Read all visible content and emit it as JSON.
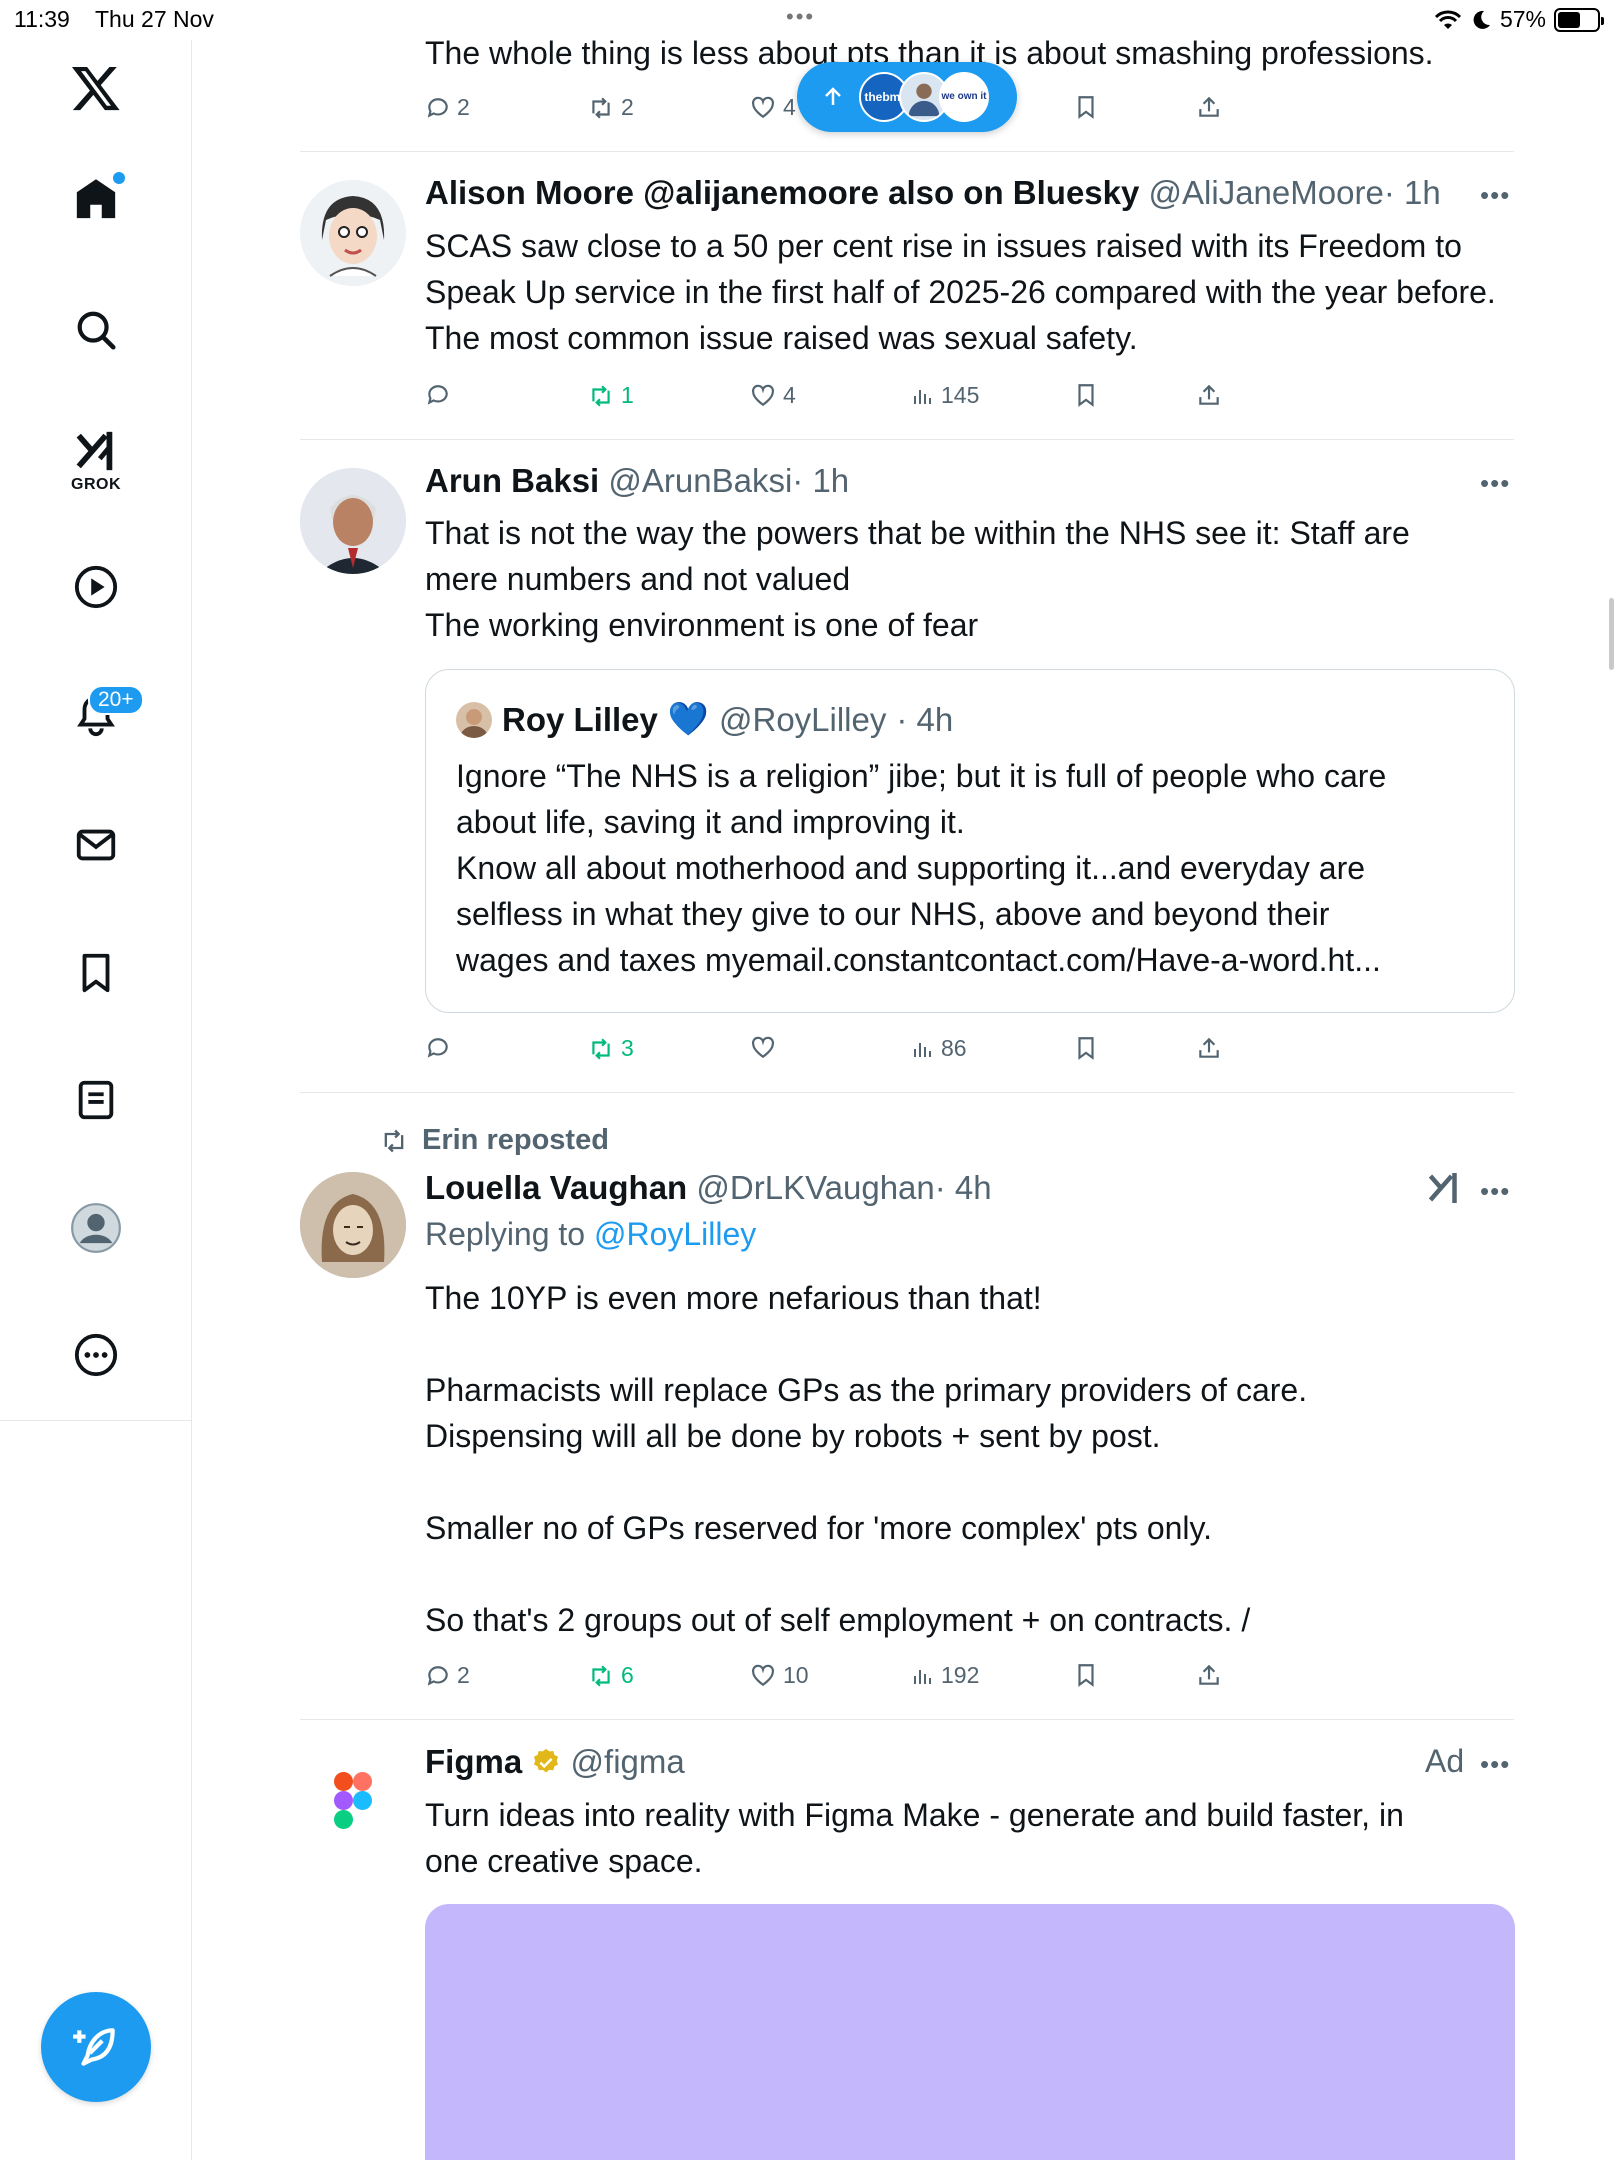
{
  "status_bar": {
    "time": "11:39",
    "date": "Thu 27 Nov",
    "battery": "57%",
    "battery_level": 0.57
  },
  "sidebar": {
    "notifications_badge": "20+",
    "grok_label": "GROK"
  },
  "new_posts_pill": {
    "avatar_1_text": "thebmj",
    "avatar_3_text": "we own it"
  },
  "posts": [
    {
      "text": "The whole thing is less about pts than it is about smashing professions.",
      "replies": "2",
      "reposts": "2",
      "likes": "4",
      "views": ""
    },
    {
      "display_name": "Alison Moore @alijanemoore also on Bluesky",
      "handle": "@AliJaneMoore",
      "time": "· 1h",
      "text": "SCAS saw close to a 50 per cent rise in issues raised with its Freedom to Speak Up service in the first half of 2025-26 compared with the year before. The most common issue raised was sexual safety.",
      "replies": "",
      "reposts": "1",
      "likes": "4",
      "views": "145"
    },
    {
      "display_name": "Arun Baksi",
      "handle": "@ArunBaksi",
      "time": "· 1h",
      "text_lines": [
        "That is not the way the powers that be within the NHS see it: Staff are",
        "mere numbers and not valued",
        "The working environment is one of fear"
      ],
      "quote": {
        "display_name": "Roy Lilley",
        "emoji": "💙",
        "handle": "@RoyLilley",
        "time": "· 4h",
        "text_lines": [
          "Ignore “The NHS is a religion” jibe; but it is full of people who care",
          "about life, saving it and improving it.",
          "Know all about motherhood and supporting it...and everyday are",
          "selfless in what they give to our NHS, above and beyond their",
          "wages and taxes myemail.constantcontact.com/Have-a-word.ht..."
        ]
      },
      "replies": "",
      "reposts": "3",
      "likes": "",
      "views": "86"
    },
    {
      "reposted_by": "Erin reposted",
      "display_name": "Louella Vaughan",
      "handle": "@DrLKVaughan",
      "time": "· 4h",
      "replying_prefix": "Replying to",
      "replying_to": "@RoyLilley",
      "text_lines": [
        "The 10YP is even more nefarious than that!",
        "",
        "Pharmacists will replace GPs as the primary providers of care.",
        "Dispensing will all be done by robots + sent by post.",
        "",
        "Smaller no of GPs reserved for 'more complex' pts only.",
        "",
        "So that's 2 groups out of self employment + on contracts. /"
      ],
      "replies": "2",
      "reposts": "6",
      "likes": "10",
      "views": "192"
    },
    {
      "display_name": "Figma",
      "handle": "@figma",
      "ad_label": "Ad",
      "text_lines": [
        "Turn ideas into reality with Figma Make - generate and build faster, in",
        "one creative space."
      ]
    }
  ],
  "colors": {
    "accent": "#1d9bf0",
    "repost_green": "#00ba7c",
    "secondary_text": "#536471",
    "divider": "#e6e9ec",
    "ad_media": "#c4b7fb"
  }
}
